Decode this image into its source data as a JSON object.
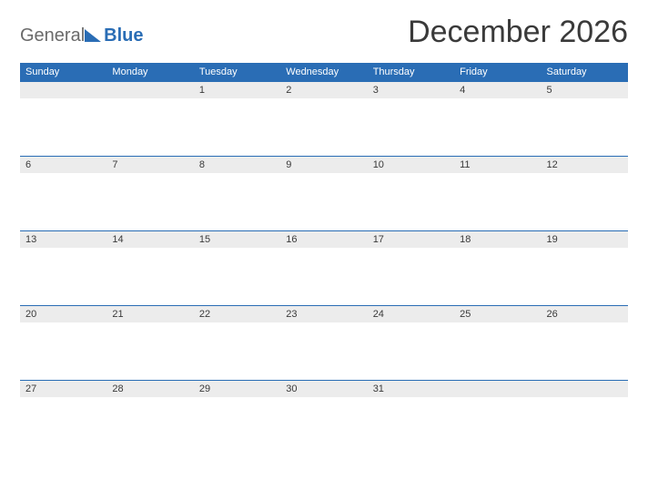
{
  "brand": {
    "part1": "General",
    "part2": "Blue"
  },
  "title": "December 2026",
  "weekdays": [
    "Sunday",
    "Monday",
    "Tuesday",
    "Wednesday",
    "Thursday",
    "Friday",
    "Saturday"
  ],
  "weeks": [
    [
      "",
      "",
      "1",
      "2",
      "3",
      "4",
      "5"
    ],
    [
      "6",
      "7",
      "8",
      "9",
      "10",
      "11",
      "12"
    ],
    [
      "13",
      "14",
      "15",
      "16",
      "17",
      "18",
      "19"
    ],
    [
      "20",
      "21",
      "22",
      "23",
      "24",
      "25",
      "26"
    ],
    [
      "27",
      "28",
      "29",
      "30",
      "31",
      "",
      ""
    ]
  ],
  "colors": {
    "accent": "#2a6db5",
    "daybar": "#ececec"
  }
}
